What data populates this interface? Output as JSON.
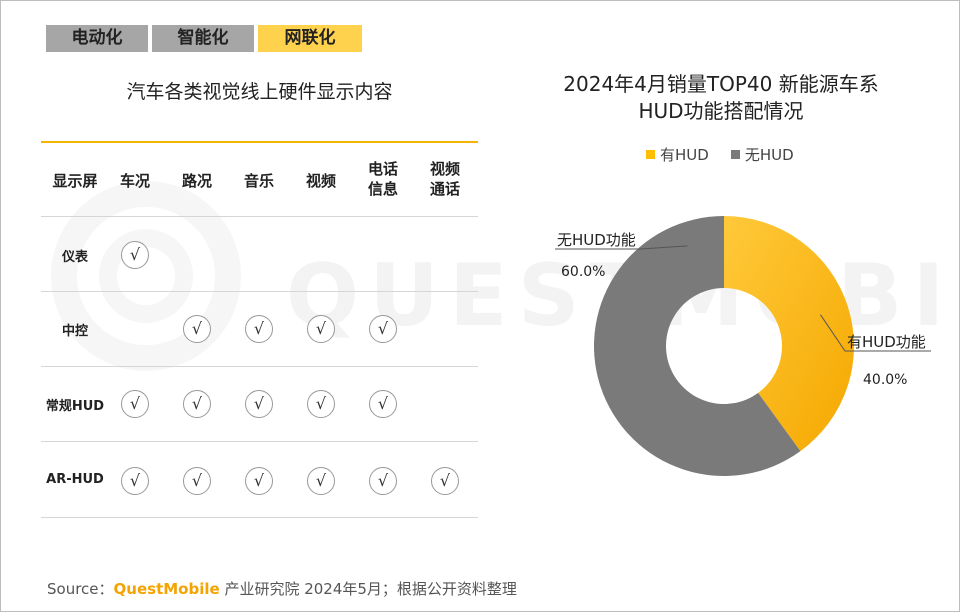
{
  "tabs": [
    {
      "label": "电动化",
      "active": false
    },
    {
      "label": "智能化",
      "active": false
    },
    {
      "label": "网联化",
      "active": true
    }
  ],
  "watermark": "QUESTMOBILE",
  "table": {
    "title": "汽车各类视觉线上硬件显示内容",
    "headers": [
      "显示屏",
      "车况",
      "路况",
      "音乐",
      "视频",
      "电话\n信息",
      "视频\n通话"
    ],
    "check_symbol": "√",
    "rows": [
      {
        "label": "仪表",
        "checks": [
          true,
          false,
          false,
          false,
          false,
          false
        ]
      },
      {
        "label": "中控",
        "checks": [
          false,
          true,
          true,
          true,
          true,
          false
        ]
      },
      {
        "label": "常规HUD",
        "checks": [
          true,
          true,
          true,
          true,
          true,
          false
        ]
      },
      {
        "label": "AR-HUD",
        "checks": [
          true,
          true,
          true,
          true,
          true,
          true
        ]
      }
    ]
  },
  "chart_data": {
    "type": "pie",
    "donut": true,
    "title": "2024年4月销量TOP40 新能源车系\nHUD功能搭配情况",
    "legend": [
      "有HUD",
      "无HUD"
    ],
    "legend_position": "top-center",
    "slices": [
      {
        "name": "有HUD",
        "label": "有HUD功能",
        "value": 40.0,
        "display": "40.0%",
        "color": "#ffbe00"
      },
      {
        "name": "无HUD",
        "label": "无HUD功能",
        "value": 60.0,
        "display": "60.0%",
        "color": "#7a7a7a"
      }
    ]
  },
  "source": {
    "prefix": "Source：",
    "brand": "QuestMobile",
    "suffix": " 产业研究院 2024年5月；根据公开资料整理"
  },
  "colors": {
    "accent": "#ffd24d",
    "tab_inactive": "#a6a6a6",
    "table_rule": "#f4b400"
  }
}
